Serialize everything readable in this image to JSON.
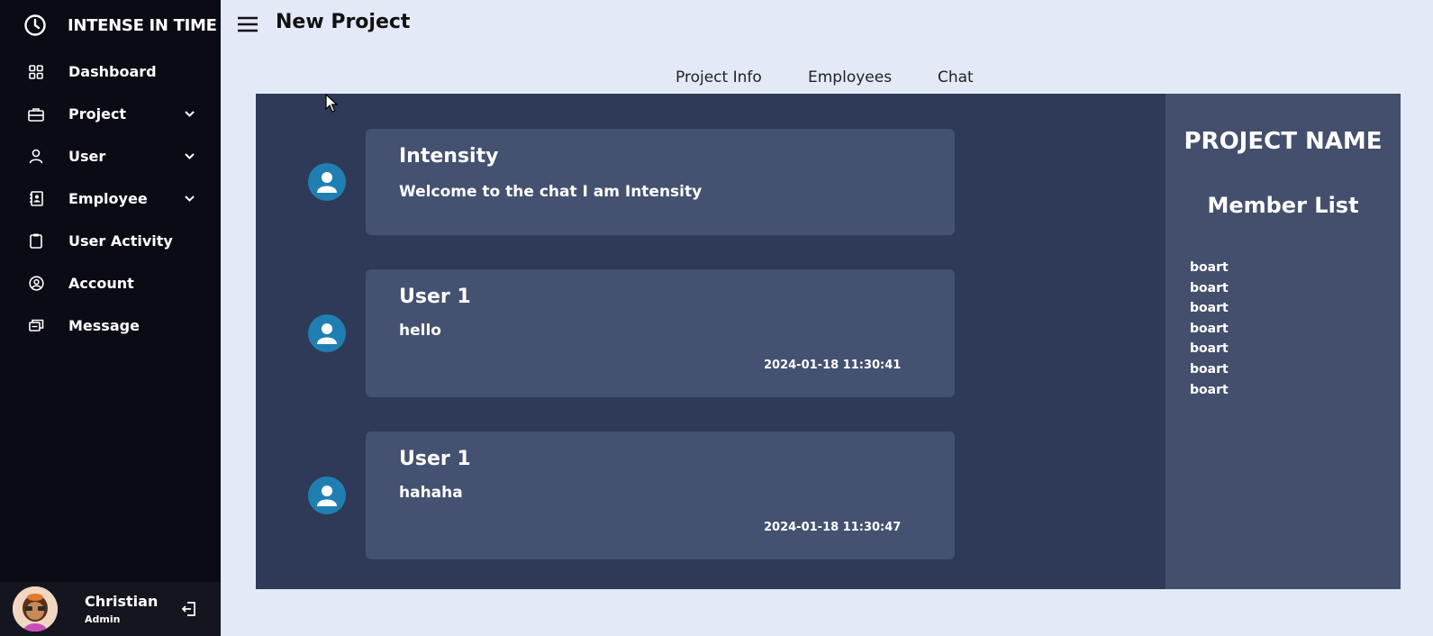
{
  "sidebar": {
    "brand_title": "INTENSE IN TIME",
    "brand_icon": "clock-icon",
    "items": [
      {
        "label": "Dashboard",
        "icon": "grid-icon",
        "has_chevron": false
      },
      {
        "label": "Project",
        "icon": "briefcase-icon",
        "has_chevron": true
      },
      {
        "label": "User",
        "icon": "user-icon",
        "has_chevron": true
      },
      {
        "label": "Employee",
        "icon": "contacts-book-icon",
        "has_chevron": true
      },
      {
        "label": "User Activity",
        "icon": "clipboard-icon",
        "has_chevron": false
      },
      {
        "label": "Account",
        "icon": "account-circle-icon",
        "has_chevron": false
      },
      {
        "label": "Message",
        "icon": "message-icon",
        "has_chevron": false
      }
    ],
    "profile": {
      "name": "Christian",
      "role": "Admin",
      "logout_icon": "logout-icon"
    }
  },
  "header": {
    "title": "New Project",
    "menu_icon": "hamburger-menu-icon"
  },
  "tabs": [
    {
      "label": "Project Info"
    },
    {
      "label": "Employees"
    },
    {
      "label": "Chat"
    }
  ],
  "chat": {
    "messages": [
      {
        "name": "Intensity",
        "text": "Welcome to the chat I am Intensity",
        "time": ""
      },
      {
        "name": "User 1",
        "text": "hello",
        "time": "2024-01-18 11:30:41"
      },
      {
        "name": "User 1",
        "text": "hahaha",
        "time": "2024-01-18 11:30:47"
      }
    ]
  },
  "project_panel": {
    "title": "PROJECT NAME",
    "member_list_title": "Member List",
    "members": [
      "boart",
      "boart",
      "boart",
      "boart",
      "boart",
      "boart",
      "boart"
    ]
  },
  "colors": {
    "sidebar_bg": "#0b0b16",
    "page_bg": "#e3e9f6",
    "chat_bg": "#2e3a57",
    "card_bg": "#445170",
    "right_panel_bg": "#434f6d",
    "avatar_bg": "#1f7fb3"
  }
}
